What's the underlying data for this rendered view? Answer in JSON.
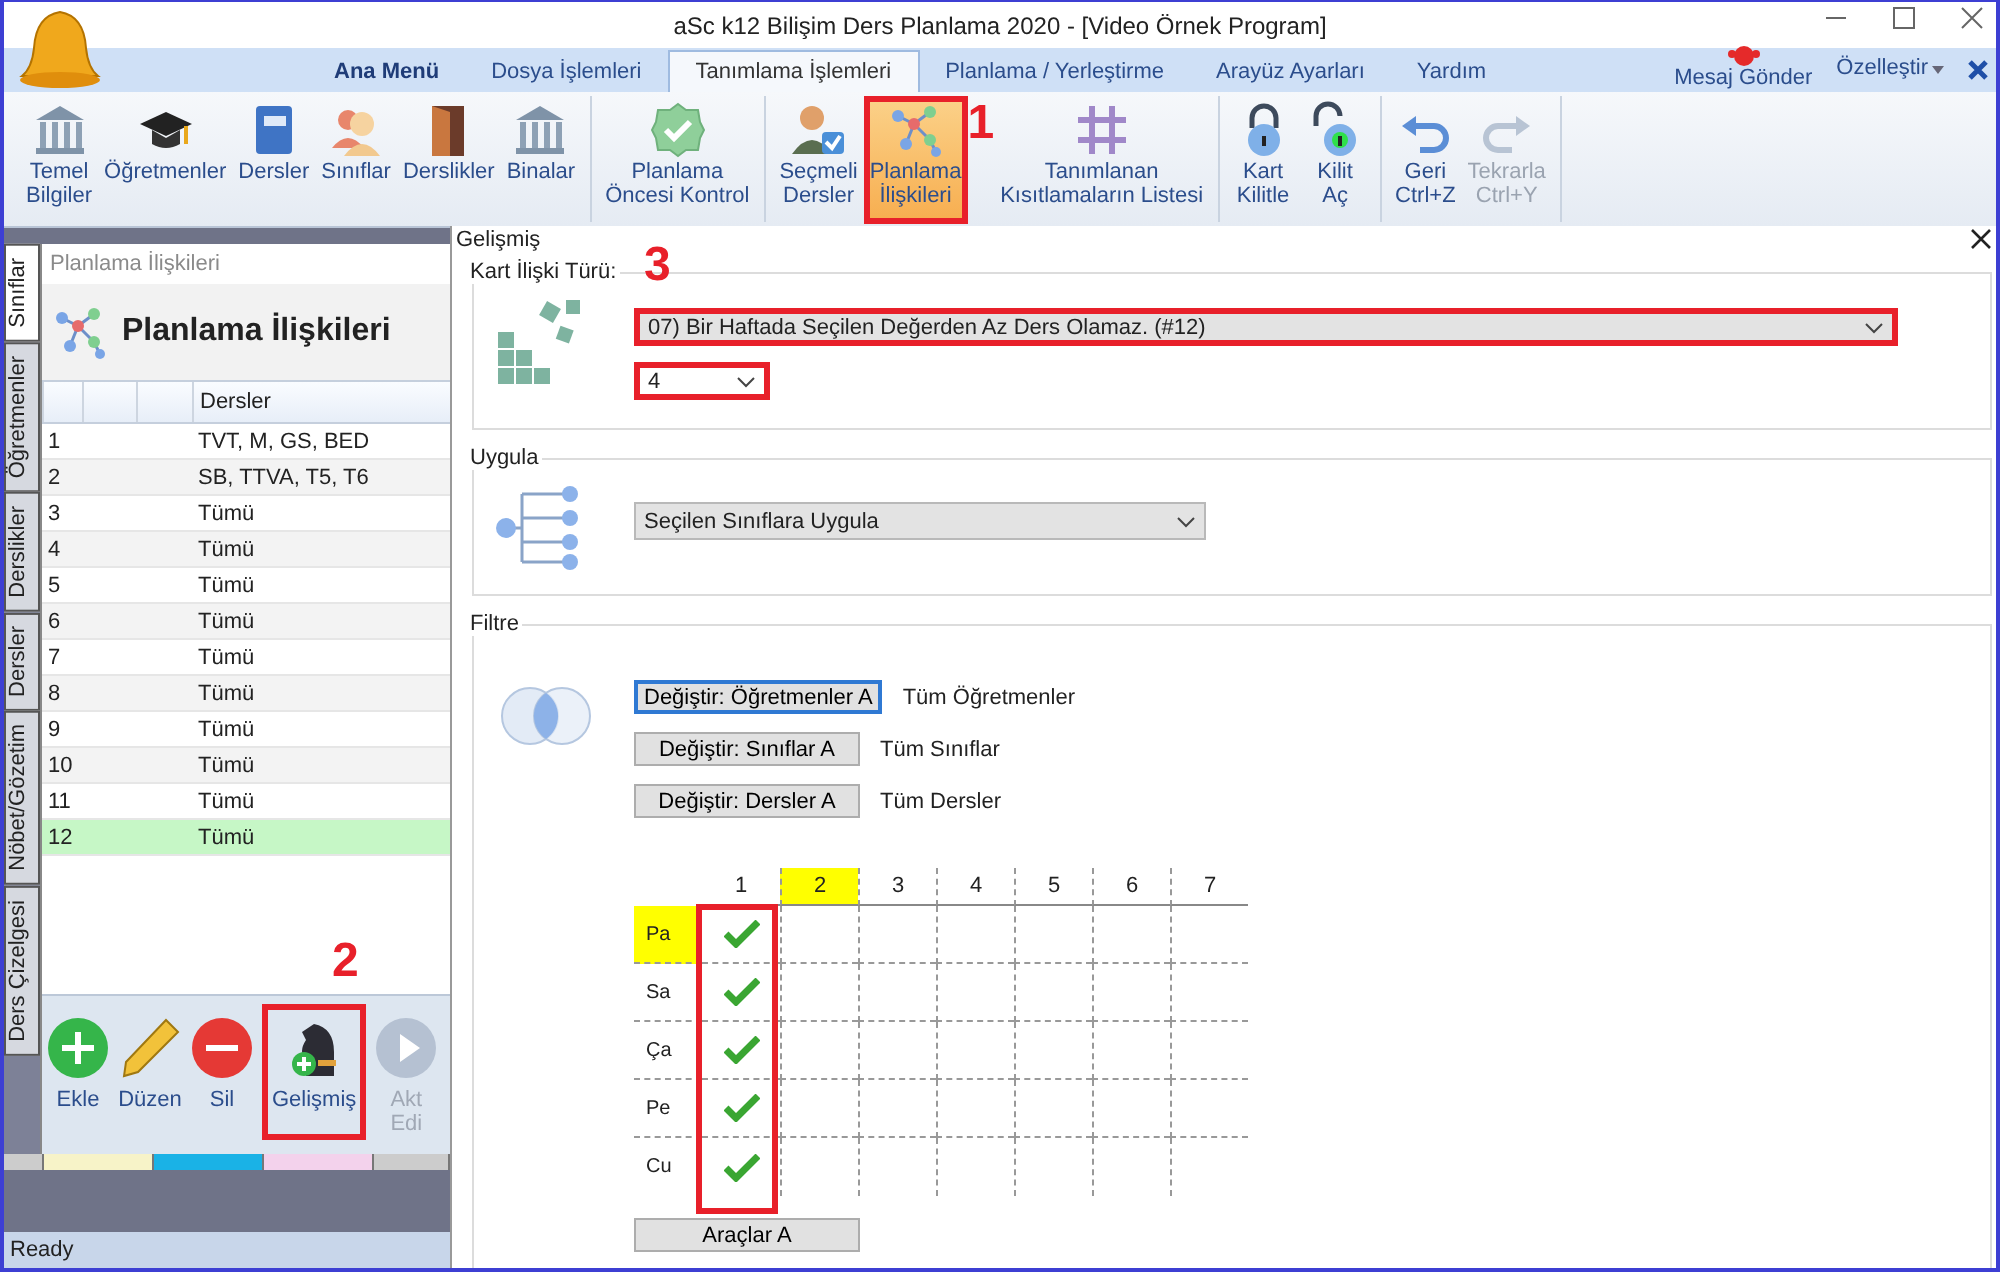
{
  "window": {
    "title": "aSc k12 Bilişim Ders Planlama 2020  - [Video Örnek Program]"
  },
  "menu_tabs": [
    {
      "label": "Ana Menü",
      "kind": "app",
      "selected": false
    },
    {
      "label": "Dosya İşlemleri",
      "kind": "tab",
      "selected": false
    },
    {
      "label": "Tanımlama İşlemleri",
      "kind": "tab",
      "selected": true
    },
    {
      "label": "Planlama / Yerleştirme",
      "kind": "tab",
      "selected": false
    },
    {
      "label": "Arayüz Ayarları",
      "kind": "tab",
      "selected": false
    },
    {
      "label": "Yardım",
      "kind": "tab",
      "selected": false
    }
  ],
  "menu_right": {
    "message": "Mesaj Gönder",
    "customize": "Özelleştir"
  },
  "ribbon": [
    [
      {
        "kind": "bank",
        "lines": [
          "Temel",
          "Bilgiler"
        ]
      },
      {
        "kind": "cap",
        "lines": [
          "Öğretmenler"
        ]
      },
      {
        "kind": "book",
        "lines": [
          "Dersler"
        ]
      },
      {
        "kind": "people",
        "lines": [
          "Sınıflar"
        ]
      },
      {
        "kind": "door",
        "lines": [
          "Derslikler"
        ]
      },
      {
        "kind": "bank",
        "lines": [
          "Binalar"
        ]
      }
    ],
    [
      {
        "kind": "check",
        "lines": [
          "Planlama",
          "Öncesi Kontrol"
        ]
      }
    ],
    [
      {
        "kind": "personcheck",
        "lines": [
          "Seçmeli",
          "Dersler"
        ]
      },
      {
        "kind": "network",
        "lines": [
          "Planlama",
          "İlişkileri"
        ],
        "highlighted": true,
        "marker": "1"
      },
      {
        "kind": "hash",
        "lines": [
          "Tanımlanan",
          "Kısıtlamaların Listesi"
        ]
      }
    ],
    [
      {
        "kind": "lock",
        "lines": [
          "Kart",
          "Kilitle"
        ]
      },
      {
        "kind": "unlock",
        "lines": [
          "Kilit",
          "Aç"
        ]
      }
    ],
    [
      {
        "kind": "undo",
        "lines": [
          "Geri",
          "Ctrl+Z"
        ]
      },
      {
        "kind": "redo",
        "lines": [
          "Tekrarla",
          "Ctrl+Y"
        ],
        "disabled": true
      }
    ]
  ],
  "side_tabs": [
    {
      "label": "Sınıflar",
      "selected": true
    },
    {
      "label": "Öğretmenler",
      "selected": false
    },
    {
      "label": "Derslikler",
      "selected": false
    },
    {
      "label": "Dersler",
      "selected": false
    },
    {
      "label": "Nöbet/Gözetim",
      "selected": false
    },
    {
      "label": "Ders Çizelgesi",
      "selected": false
    }
  ],
  "panel": {
    "window_title": "Planlama İlişkileri",
    "heading": "Planlama İlişkileri",
    "column": "Dersler",
    "rows": [
      {
        "number": "1",
        "lessons": "TVT, M, GS, BED",
        "selected": false
      },
      {
        "number": "2",
        "lessons": "SB, TTVA, T5, T6",
        "selected": false
      },
      {
        "number": "3",
        "lessons": "Tümü",
        "selected": false
      },
      {
        "number": "4",
        "lessons": "Tümü",
        "selected": false
      },
      {
        "number": "5",
        "lessons": "Tümü",
        "selected": false
      },
      {
        "number": "6",
        "lessons": "Tümü",
        "selected": false
      },
      {
        "number": "7",
        "lessons": "Tümü",
        "selected": false
      },
      {
        "number": "8",
        "lessons": "Tümü",
        "selected": false
      },
      {
        "number": "9",
        "lessons": "Tümü",
        "selected": false
      },
      {
        "number": "10",
        "lessons": "Tümü",
        "selected": false
      },
      {
        "number": "11",
        "lessons": "Tümü",
        "selected": false
      },
      {
        "number": "12",
        "lessons": "Tümü",
        "selected": true
      }
    ],
    "buttons": [
      {
        "kind": "add",
        "lines": [
          "Ekle"
        ]
      },
      {
        "kind": "edit",
        "lines": [
          "Düzen"
        ]
      },
      {
        "kind": "delete",
        "lines": [
          "Sil"
        ]
      },
      {
        "kind": "advanced",
        "lines": [
          "Gelişmiş"
        ],
        "highlighted": true,
        "marker": "2"
      },
      {
        "kind": "play",
        "lines": [
          "Akt",
          "Edi"
        ],
        "disabled": true
      }
    ]
  },
  "status_bar": "Ready",
  "dialog": {
    "title": "Gelişmiş",
    "marker": "3",
    "relation": {
      "label": "Kart İlişki Türü:",
      "value": "07) Bir Haftada Seçilen Değerden Az Ders Olamaz. (#12)",
      "highlighted": true,
      "count": "4",
      "count_highlighted": true
    },
    "apply": {
      "label": "Uygula",
      "value": "Seçilen Sınıflara Uygula"
    },
    "filter": {
      "label": "Filtre",
      "rows": [
        {
          "button": "Değiştir: Öğretmenler A",
          "value": "Tüm Öğretmenler",
          "focused": true
        },
        {
          "button": "Değiştir: Sınıflar A",
          "value": "Tüm Sınıflar",
          "focused": false
        },
        {
          "button": "Değiştir: Dersler A",
          "value": "Tüm Dersler",
          "focused": false
        }
      ],
      "grid": {
        "columns": [
          {
            "label": "1",
            "selected": false,
            "highlighted": true
          },
          {
            "label": "2",
            "selected": true,
            "highlighted": false
          },
          {
            "label": "3",
            "selected": false,
            "highlighted": false
          },
          {
            "label": "4",
            "selected": false,
            "highlighted": false
          },
          {
            "label": "5",
            "selected": false,
            "highlighted": false
          },
          {
            "label": "6",
            "selected": false,
            "highlighted": false
          },
          {
            "label": "7",
            "selected": false,
            "highlighted": false
          }
        ],
        "rows": [
          {
            "label": "Pa",
            "selected": true,
            "checked": [
              true,
              false,
              false,
              false,
              false,
              false,
              false
            ]
          },
          {
            "label": "Sa",
            "selected": false,
            "checked": [
              true,
              false,
              false,
              false,
              false,
              false,
              false
            ]
          },
          {
            "label": "Ça",
            "selected": false,
            "checked": [
              true,
              false,
              false,
              false,
              false,
              false,
              false
            ]
          },
          {
            "label": "Pe",
            "selected": false,
            "checked": [
              true,
              false,
              false,
              false,
              false,
              false,
              false
            ]
          },
          {
            "label": "Cu",
            "selected": false,
            "checked": [
              true,
              false,
              false,
              false,
              false,
              false,
              false
            ]
          }
        ]
      },
      "tools_button": "Araçlar A"
    }
  }
}
